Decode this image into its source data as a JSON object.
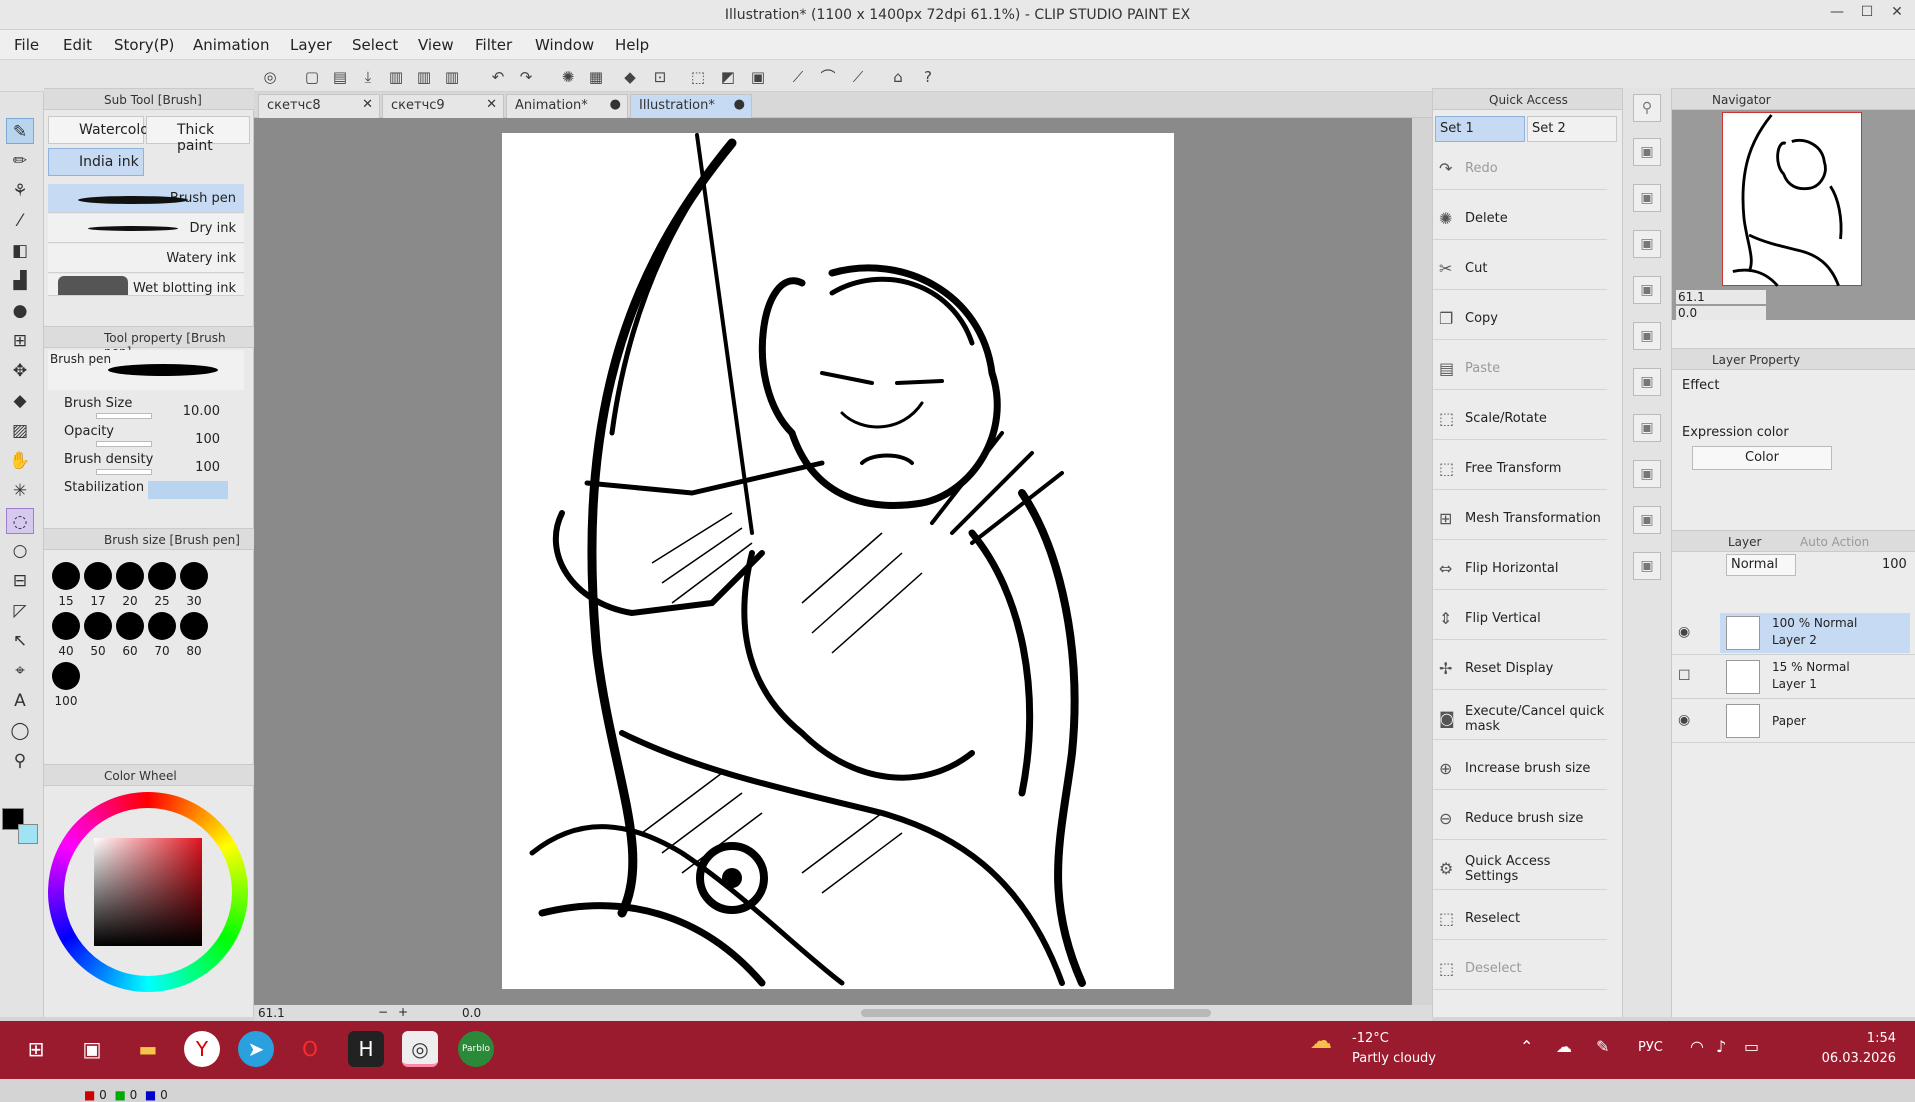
{
  "window": {
    "title": "Illustration* (1100 x 1400px 72dpi 61.1%) - CLIP STUDIO PAINT EX"
  },
  "menu": [
    "File",
    "Edit",
    "Story(P)",
    "Animation",
    "Layer",
    "Select",
    "View",
    "Filter",
    "Window",
    "Help"
  ],
  "subtool": {
    "header": "Sub Tool [Brush]",
    "buttons": [
      "Watercolor",
      "Thick paint",
      "India ink"
    ],
    "selected": "India ink",
    "brushes": [
      "Brush pen",
      "Dry ink",
      "Watery ink",
      "Wet blotting ink"
    ],
    "selected_brush": "Brush pen"
  },
  "toolprop": {
    "header": "Tool property [Brush pen]",
    "brush_name": "Brush pen",
    "props": [
      {
        "label": "Brush Size",
        "value": "10.00"
      },
      {
        "label": "Opacity",
        "value": "100"
      },
      {
        "label": "Brush density",
        "value": "100"
      },
      {
        "label": "Stabilization",
        "value": ""
      }
    ]
  },
  "brushsize": {
    "header": "Brush size [Brush pen]",
    "sizes": [
      "15",
      "17",
      "20",
      "25",
      "30",
      "40",
      "50",
      "60",
      "70",
      "80",
      "100"
    ]
  },
  "colorwheel": {
    "header": "Color Wheel",
    "rgb": [
      "0",
      "0",
      "0"
    ],
    "main_color": "#000000",
    "sub_color": "#a0e4f4"
  },
  "tabs": [
    {
      "label": "скетчс8",
      "marker": "✕"
    },
    {
      "label": "скетчс9",
      "marker": "✕"
    },
    {
      "label": "Animation*",
      "marker": "●"
    },
    {
      "label": "Illustration*",
      "marker": "●"
    }
  ],
  "selected_tab": "Illustration*",
  "status": {
    "zoom": "61.1",
    "angle": "0.0"
  },
  "quick_access": {
    "header": "Quick Access",
    "sets": [
      "Set 1",
      "Set 2"
    ],
    "items": [
      {
        "label": "Redo",
        "icon": "redo-icon",
        "enabled": false
      },
      {
        "label": "Delete",
        "icon": "delete-icon",
        "enabled": true
      },
      {
        "label": "Cut",
        "icon": "scissors-icon",
        "enabled": true
      },
      {
        "label": "Copy",
        "icon": "copy-icon",
        "enabled": true
      },
      {
        "label": "Paste",
        "icon": "paste-icon",
        "enabled": false
      },
      {
        "label": "Scale/Rotate",
        "icon": "scale-rotate-icon",
        "enabled": true
      },
      {
        "label": "Free Transform",
        "icon": "free-transform-icon",
        "enabled": true
      },
      {
        "label": "Mesh Transformation",
        "icon": "mesh-icon",
        "enabled": true
      },
      {
        "label": "Flip Horizontal",
        "icon": "flip-horizontal-icon",
        "enabled": true
      },
      {
        "label": "Flip Vertical",
        "icon": "flip-vertical-icon",
        "enabled": true
      },
      {
        "label": "Reset Display",
        "icon": "reset-display-icon",
        "enabled": true
      },
      {
        "label": "Execute/Cancel quick mask",
        "icon": "quick-mask-icon",
        "enabled": true
      },
      {
        "label": "Increase brush size",
        "icon": "increase-brush-icon",
        "enabled": true
      },
      {
        "label": "Reduce brush size",
        "icon": "reduce-brush-icon",
        "enabled": true
      },
      {
        "label": "Quick Access Settings",
        "icon": "settings-icon",
        "enabled": true
      },
      {
        "label": "Reselect",
        "icon": "reselect-icon",
        "enabled": true
      },
      {
        "label": "Deselect",
        "icon": "deselect-icon",
        "enabled": false
      }
    ]
  },
  "navigator": {
    "header": "Navigator",
    "zoom": "61.1",
    "rotation": "0.0"
  },
  "layer_property": {
    "header": "Layer Property",
    "effect_label": "Effect",
    "expression_label": "Expression color",
    "expression_value": "Color"
  },
  "layers": {
    "header": "Layer",
    "auto_action": "Auto Action",
    "blend_mode": "Normal",
    "opacity": "100",
    "items": [
      {
        "opacity_mode": "100 % Normal",
        "name": "Layer 2",
        "visible": true,
        "selected": true
      },
      {
        "opacity_mode": "15 % Normal",
        "name": "Layer 1",
        "visible": false,
        "selected": false
      },
      {
        "opacity_mode": "",
        "name": "Paper",
        "visible": true,
        "selected": false
      }
    ]
  },
  "taskbar": {
    "weather_temp": "-12°C",
    "weather_desc": "Partly cloudy",
    "lang": "РУС",
    "time": "1:54",
    "date": "06.03.2026"
  }
}
